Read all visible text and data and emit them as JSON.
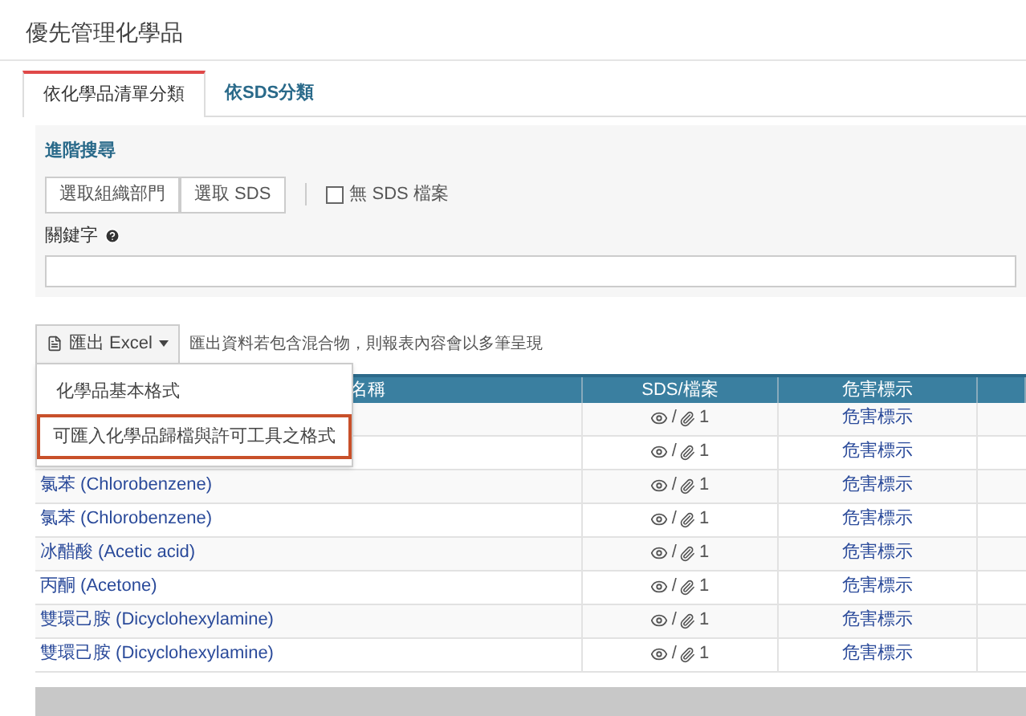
{
  "page_title": "優先管理化學品",
  "tabs": [
    {
      "label": "依化學品清單分類",
      "selected": true
    },
    {
      "label": "依SDS分類",
      "selected": false
    }
  ],
  "search_panel": {
    "title": "進階搜尋",
    "buttons": [
      "選取組織部門",
      "選取 SDS"
    ],
    "checkbox": {
      "label": "無 SDS 檔案",
      "checked": false
    },
    "keyword_label": "關鍵字"
  },
  "export": {
    "button": "匯出 Excel",
    "note": "匯出資料若包含混合物，則報表內容會以多筆呈現",
    "menu": [
      {
        "label": "化學品基本格式",
        "highlighted": false
      },
      {
        "label": "可匯入化學品歸檔與許可工具之格式",
        "highlighted": true
      }
    ]
  },
  "table": {
    "columns": [
      "名稱",
      "SDS/檔案",
      "危害標示"
    ],
    "sds_separator": "/",
    "rows": [
      {
        "sds_count": "1",
        "hazard": "危害標示"
      },
      {
        "sds_count": "1",
        "hazard": "危害標示"
      },
      {
        "name": "氯苯 (Chlorobenzene)",
        "sds_count": "1",
        "hazard": "危害標示"
      },
      {
        "name": "氯苯 (Chlorobenzene)",
        "sds_count": "1",
        "hazard": "危害標示"
      },
      {
        "name": "冰醋酸 (Acetic acid)",
        "sds_count": "1",
        "hazard": "危害標示"
      },
      {
        "name": "丙酮 (Acetone)",
        "sds_count": "1",
        "hazard": "危害標示"
      },
      {
        "name": "雙環己胺 (Dicyclohexylamine)",
        "sds_count": "1",
        "hazard": "危害標示"
      },
      {
        "name": "雙環己胺 (Dicyclohexylamine)",
        "sds_count": "1",
        "hazard": "危害標示"
      }
    ]
  }
}
